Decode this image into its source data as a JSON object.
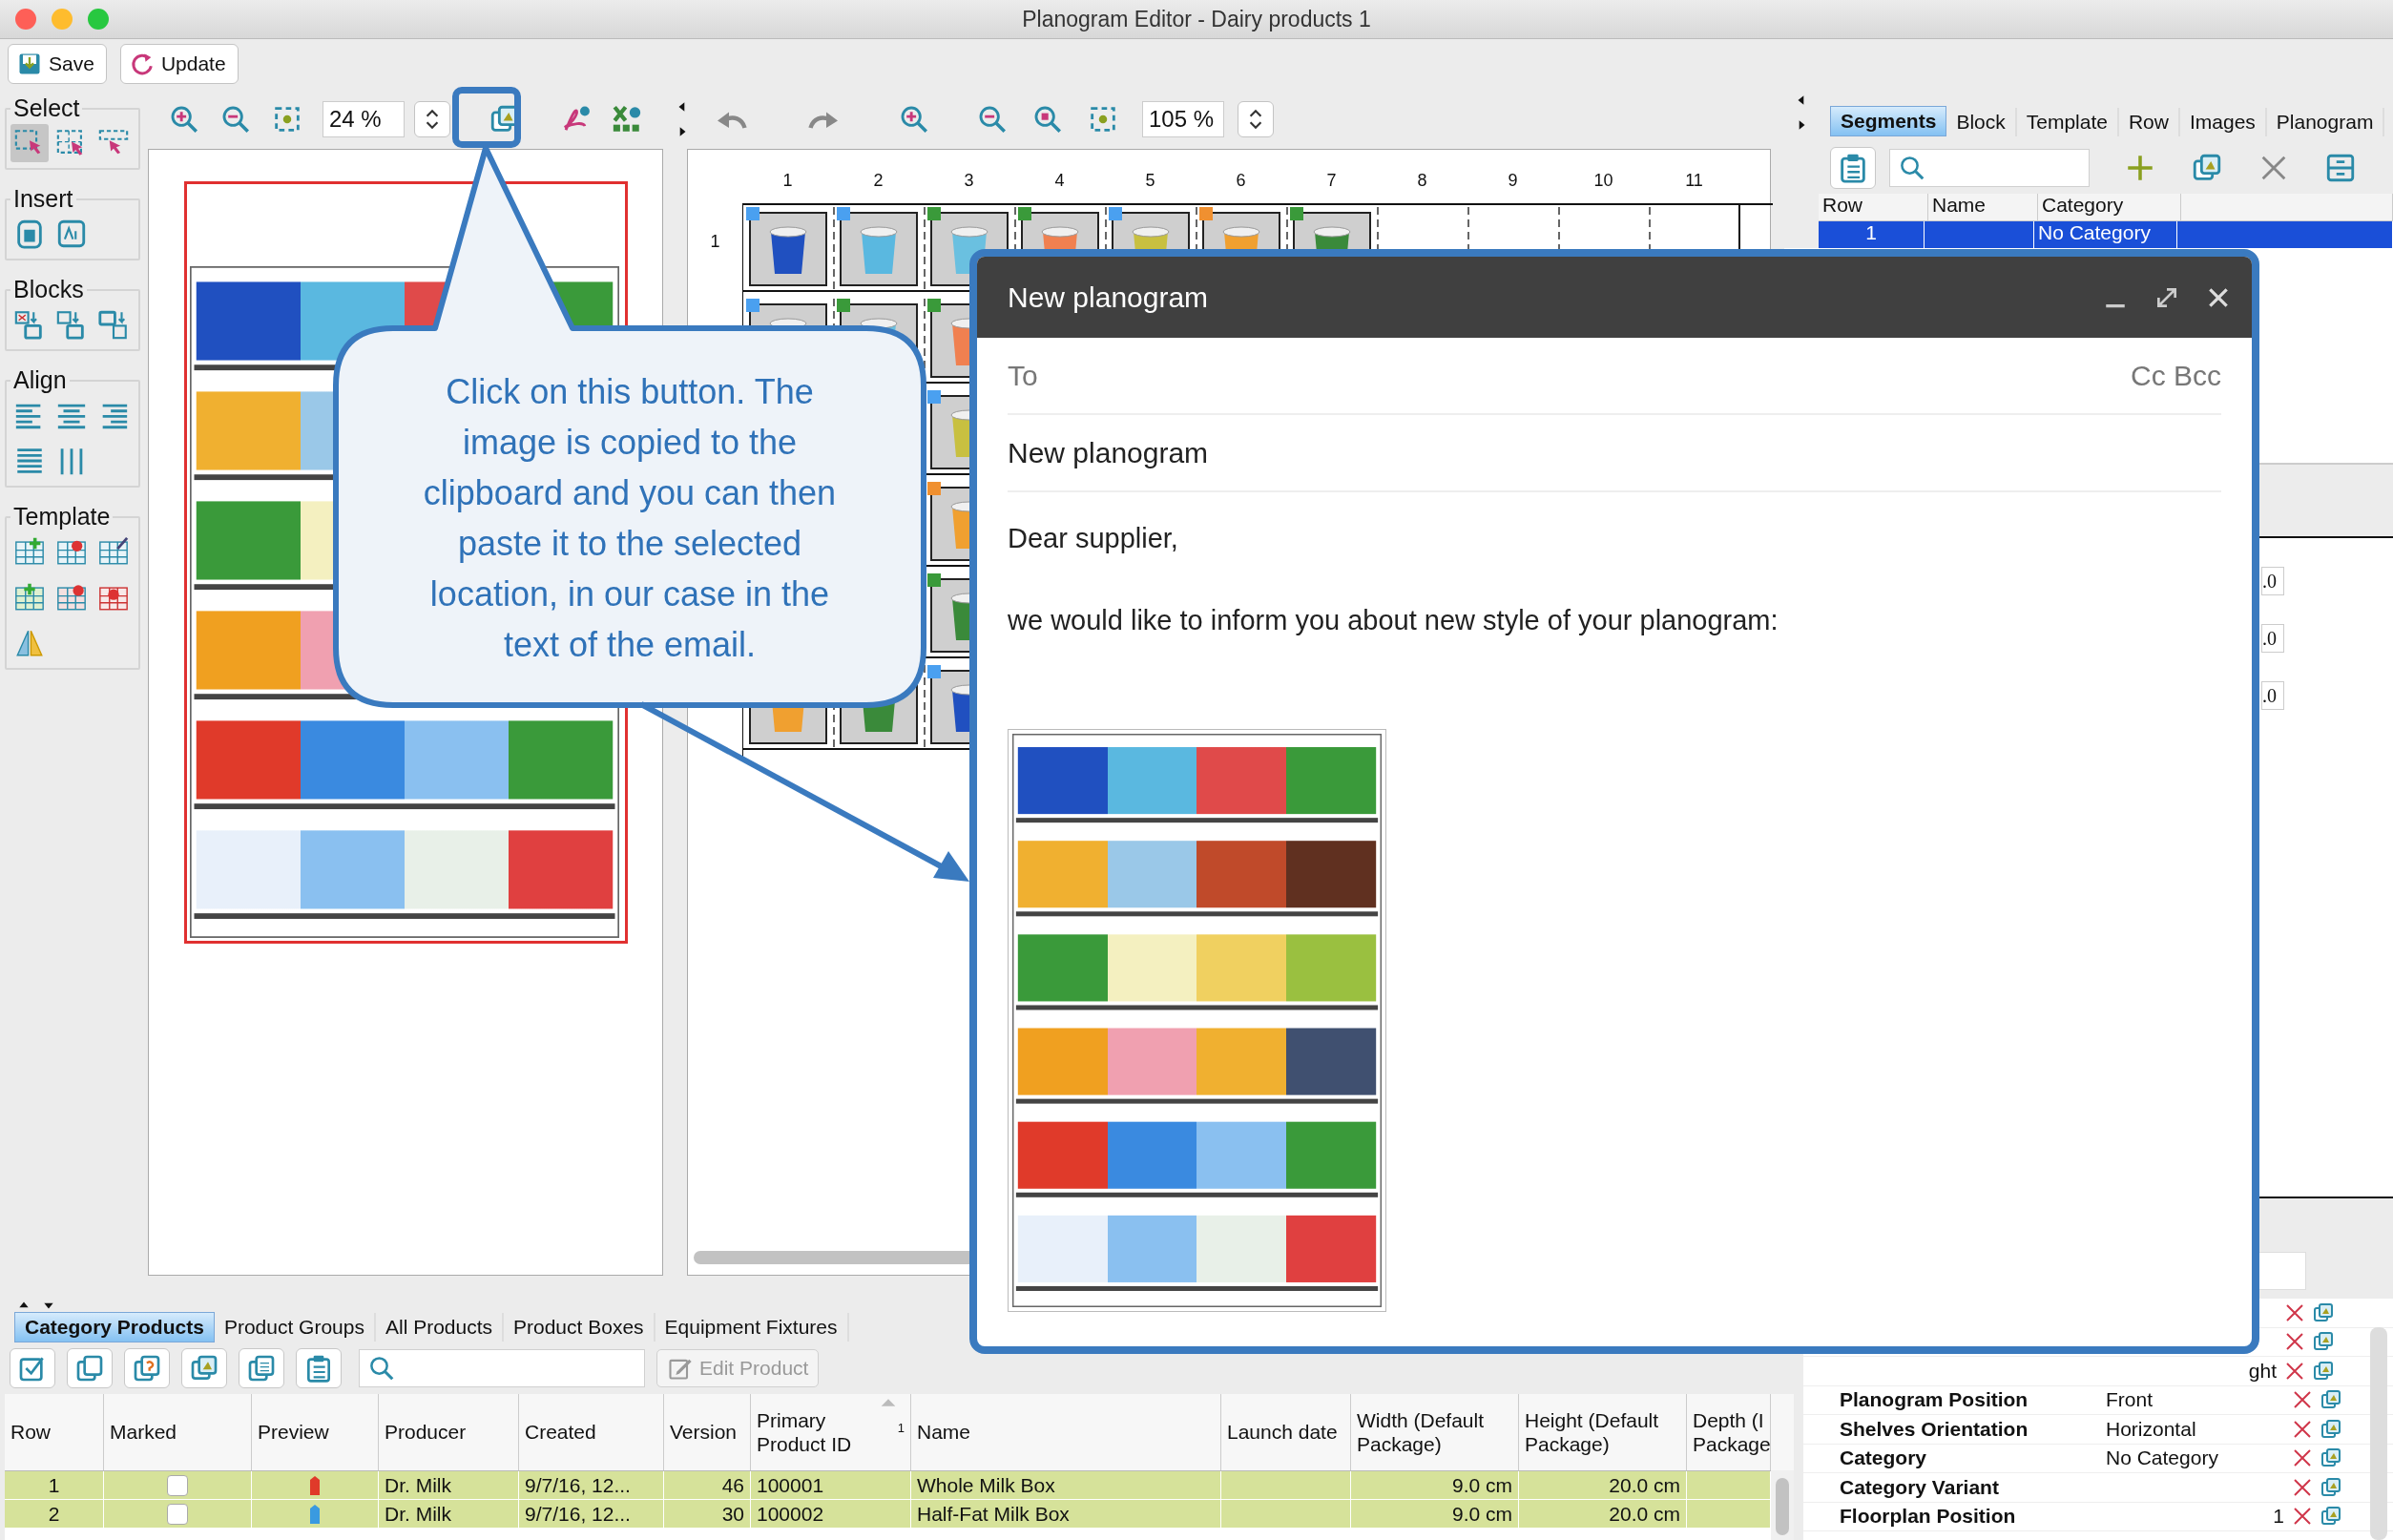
{
  "window": {
    "title": "Planogram Editor - Dairy products 1"
  },
  "main_toolbar": {
    "buttons": [
      "Save",
      "Update"
    ]
  },
  "palette": {
    "groups": [
      {
        "title": "Select"
      },
      {
        "title": "Insert"
      },
      {
        "title": "Blocks"
      },
      {
        "title": "Align"
      },
      {
        "title": "Template"
      }
    ],
    "select_tools": [
      {
        "selected": true
      },
      {
        "selected": false
      },
      {
        "selected": false
      }
    ]
  },
  "preview_toolbar": {
    "zoom": "24 %"
  },
  "canvas_toolbar": {
    "zoom": "105 %"
  },
  "shelf_grid": {
    "columns": [
      "1",
      "2",
      "3",
      "4",
      "5",
      "6",
      "7",
      "8",
      "9",
      "10",
      "11"
    ],
    "row_label": "1"
  },
  "side_panel": {
    "tabs": [
      {
        "label": "Segments",
        "selected": true
      },
      {
        "label": "Block",
        "selected": false
      },
      {
        "label": "Template",
        "selected": false
      },
      {
        "label": "Row",
        "selected": false
      },
      {
        "label": "Images",
        "selected": false
      },
      {
        "label": "Planogram",
        "selected": false
      }
    ],
    "table": {
      "columns": [
        "Row",
        "Name",
        "Category"
      ],
      "rows": [
        {
          "row": "1",
          "category": "No Category",
          "selected": true
        }
      ]
    },
    "fields": [
      ".0",
      ".0",
      ".0"
    ]
  },
  "products": {
    "tabs": [
      {
        "label": "Category Products",
        "selected": true
      },
      {
        "label": "Product Groups",
        "selected": false
      },
      {
        "label": "All Products",
        "selected": false
      },
      {
        "label": "Product Boxes",
        "selected": false
      },
      {
        "label": "Equipment Fixtures",
        "selected": false
      }
    ],
    "edit_button": {
      "label": "Edit Product",
      "disabled": true
    },
    "columns": [
      {
        "label": "Row"
      },
      {
        "label": "Marked"
      },
      {
        "label": "Preview"
      },
      {
        "label": "Producer"
      },
      {
        "label": "Created"
      },
      {
        "label": "Version"
      },
      {
        "label": "Primary Product ID",
        "sort": "1"
      },
      {
        "label": "Name"
      },
      {
        "label": "Launch date"
      },
      {
        "label": "Width (Default Package)"
      },
      {
        "label": "Height (Default Package)"
      },
      {
        "label": "Depth (I\nPackage"
      }
    ],
    "rows": [
      {
        "row": "1",
        "marked": false,
        "producer": "Dr. Milk",
        "created": "9/7/16, 12...",
        "version": "46",
        "primary_product_id": "100001",
        "name": "Whole Milk Box",
        "width": "9.0 cm",
        "height": "20.0 cm",
        "color": "#e03a2a"
      },
      {
        "row": "2",
        "marked": false,
        "producer": "Dr. Milk",
        "created": "9/7/16, 12...",
        "version": "30",
        "primary_product_id": "100002",
        "name": "Half-Fat Milk Box",
        "width": "9.0 cm",
        "height": "20.0 cm",
        "color": "#3a9ae0"
      }
    ]
  },
  "properties": [
    {
      "kind": "covered"
    },
    {
      "kind": "covered"
    },
    {
      "kind": "covered",
      "value": "ght"
    },
    {
      "kind": "text",
      "label": "Planogram Position",
      "value": "Front"
    },
    {
      "kind": "text",
      "label": "Shelves Orientation",
      "value": "Horizontal"
    },
    {
      "kind": "text",
      "label": "Category",
      "value": "No Category"
    },
    {
      "kind": "text",
      "label": "Category Variant"
    },
    {
      "kind": "number",
      "label": "Floorplan Position",
      "value": "1"
    }
  ],
  "email": {
    "title": "New planogram",
    "to_label": "To",
    "cc_bcc": "Cc Bcc",
    "subject": "New planogram",
    "body": [
      "Dear supplier,",
      "we would like to inform you about new style of your planogram:"
    ]
  },
  "callout": {
    "text": "Click on this button. The image is copied to the clipboard and you can then paste it to the selected location, in our case in the text of the email."
  }
}
